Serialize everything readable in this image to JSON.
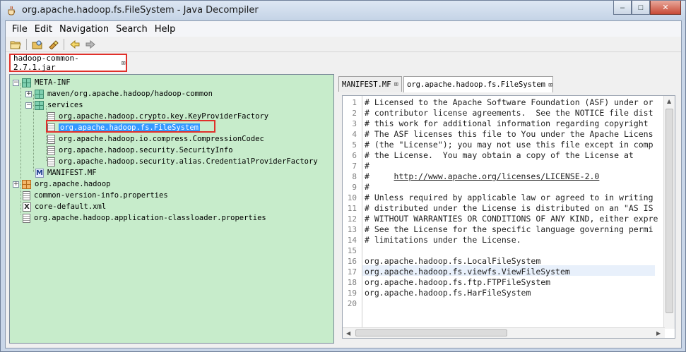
{
  "window": {
    "title": "org.apache.hadoop.fs.FileSystem - Java Decompiler",
    "minimize": "–",
    "maximize": "□",
    "close": "✕"
  },
  "menu": [
    "File",
    "Edit",
    "Navigation",
    "Search",
    "Help"
  ],
  "top_tab": {
    "label": "hadoop-common-2.7.1.jar",
    "close": "⌧"
  },
  "tree": {
    "meta_inf": "META-INF",
    "maven": "maven/org.apache.hadoop/hadoop-common",
    "services": "services",
    "svc1": "org.apache.hadoop.crypto.key.KeyProviderFactory",
    "svc2": "org.apache.hadoop.fs.FileSystem",
    "svc3": "org.apache.hadoop.io.compress.CompressionCodec",
    "svc4": "org.apache.hadoop.security.SecurityInfo",
    "svc5": "org.apache.hadoop.security.alias.CredentialProviderFactory",
    "manifest": "MANIFEST.MF",
    "org_apache": "org.apache.hadoop",
    "cvi": "common-version-info.properties",
    "core_default": "core-default.xml",
    "classloader": "org.apache.hadoop.application-classloader.properties"
  },
  "right_tabs": [
    {
      "label": "MANIFEST.MF",
      "close": "⌧"
    },
    {
      "label": "org.apache.hadoop.fs.FileSystem",
      "close": "⌧"
    }
  ],
  "code": {
    "lines": [
      "# Licensed to the Apache Software Foundation (ASF) under or",
      "# contributor license agreements.  See the NOTICE file dist",
      "# this work for additional information regarding copyright",
      "# The ASF licenses this file to You under the Apache Licens",
      "# (the \"License\"); you may not use this file except in comp",
      "# the License.  You may obtain a copy of the License at",
      "#",
      "#     http://www.apache.org/licenses/LICENSE-2.0",
      "#",
      "# Unless required by applicable law or agreed to in writing",
      "# distributed under the License is distributed on an \"AS IS",
      "# WITHOUT WARRANTIES OR CONDITIONS OF ANY KIND, either expre",
      "# See the License for the specific language governing permi",
      "# limitations under the License.",
      "",
      "org.apache.hadoop.fs.LocalFileSystem",
      "org.apache.hadoop.fs.viewfs.ViewFileSystem",
      "org.apache.hadoop.fs.ftp.FTPFileSystem",
      "org.apache.hadoop.fs.HarFileSystem",
      ""
    ],
    "numbers": [
      "1",
      "2",
      "3",
      "4",
      "5",
      "6",
      "7",
      "8",
      "9",
      "10",
      "11",
      "12",
      "13",
      "14",
      "15",
      "16",
      "17",
      "18",
      "19",
      "20"
    ]
  }
}
